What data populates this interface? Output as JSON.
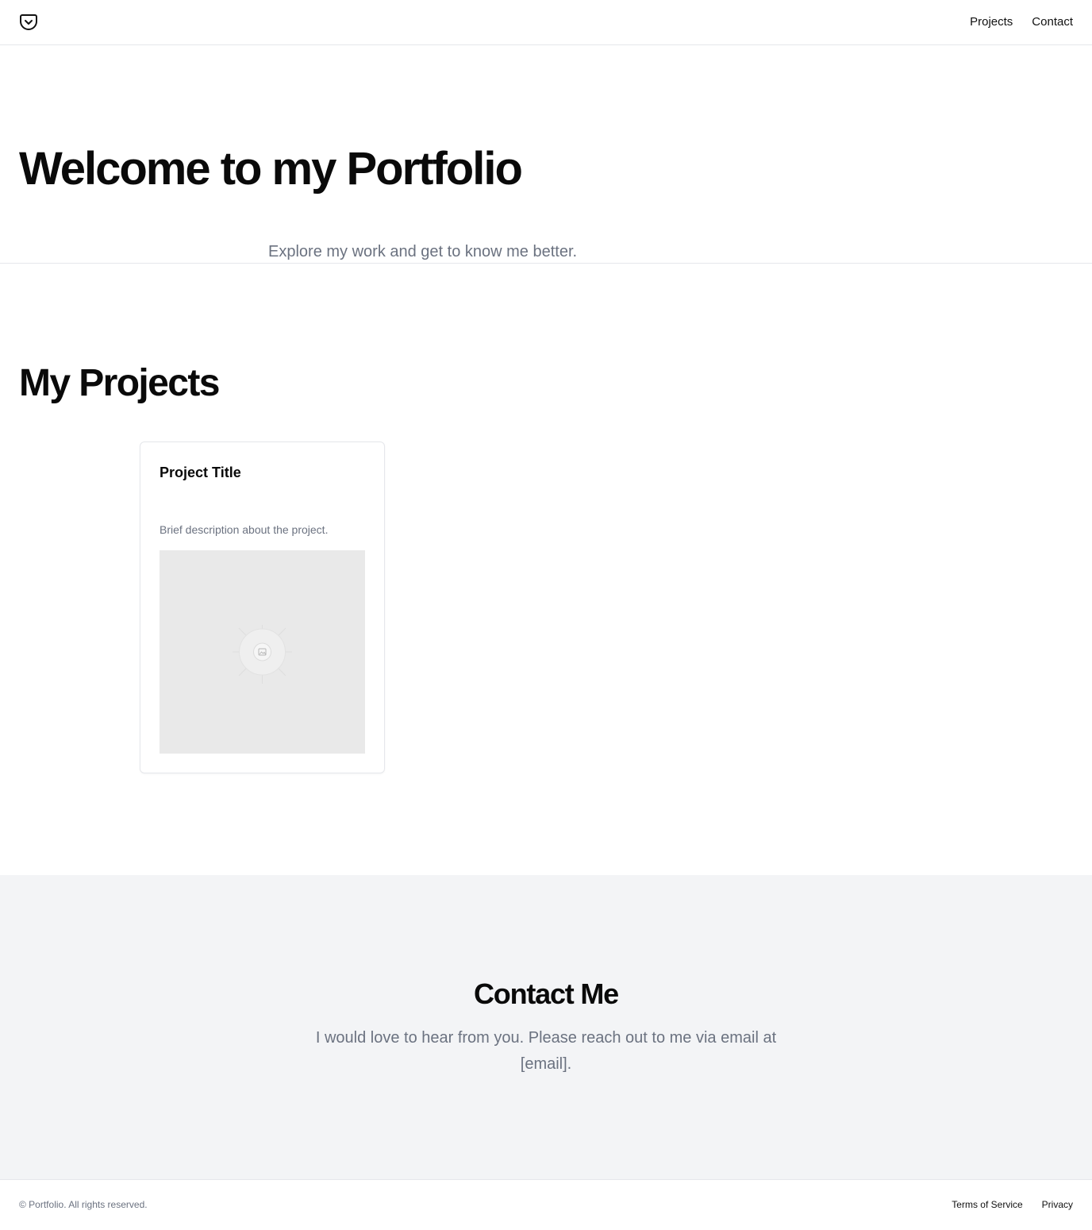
{
  "header": {
    "logo_icon": "pocket-icon",
    "nav": [
      {
        "label": "Projects"
      },
      {
        "label": "Contact"
      }
    ]
  },
  "hero": {
    "title": "Welcome to my Portfolio",
    "subtitle": "Explore my work and get to know me better."
  },
  "projects": {
    "heading": "My Projects",
    "items": [
      {
        "title": "Project Title",
        "description": "Brief description about the project.",
        "image_icon": "image-placeholder-icon"
      }
    ]
  },
  "contact": {
    "heading": "Contact Me",
    "text": "I would love to hear from you. Please reach out to me via email at [email]."
  },
  "footer": {
    "copyright": "© Portfolio. All rights reserved.",
    "links": [
      {
        "label": "Terms of Service"
      },
      {
        "label": "Privacy"
      }
    ]
  },
  "colors": {
    "text": "#0a0a0a",
    "muted": "#6b7280",
    "border": "#e5e7eb",
    "contact_bg": "#f3f4f6",
    "placeholder_bg": "#e9e9e9"
  }
}
